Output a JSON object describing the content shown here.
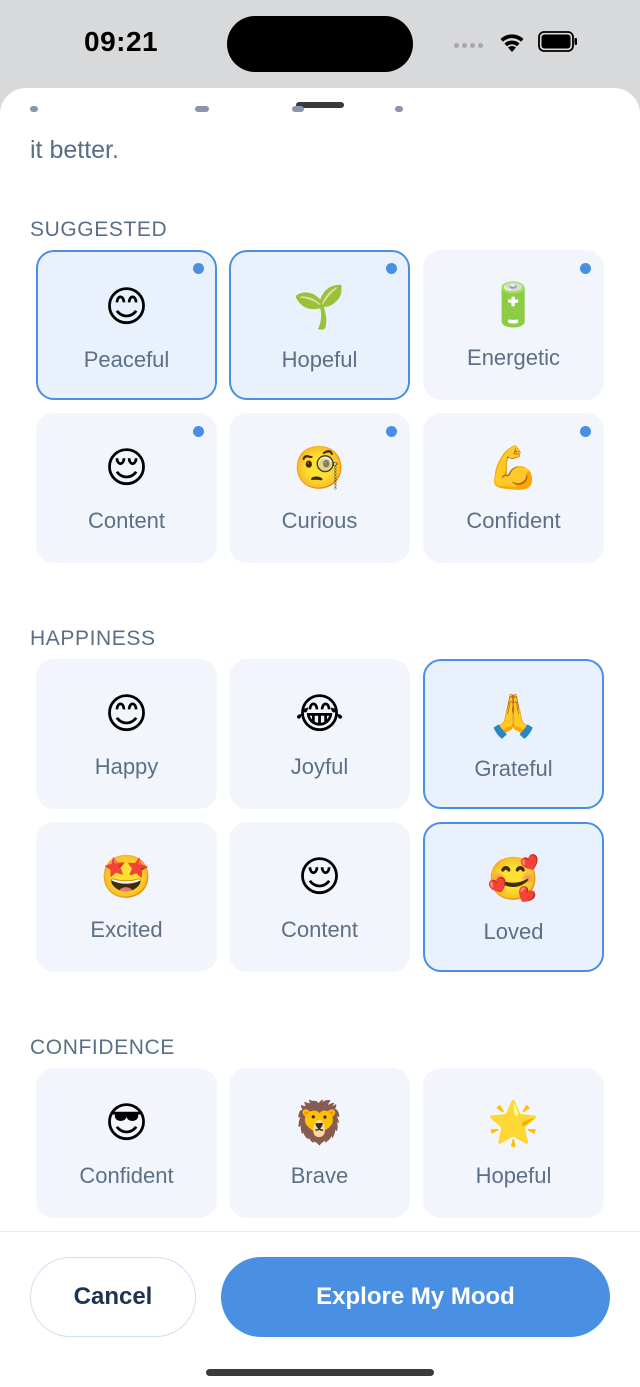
{
  "status_bar": {
    "time": "09:21"
  },
  "intro": {
    "text": "it better."
  },
  "sections": [
    {
      "title": "SUGGESTED",
      "cards": [
        {
          "emoji": "😊",
          "label": "Peaceful",
          "selected": true,
          "dot": true
        },
        {
          "emoji": "🌱",
          "label": "Hopeful",
          "selected": true,
          "dot": true
        },
        {
          "emoji": "🔋",
          "label": "Energetic",
          "selected": false,
          "dot": true
        },
        {
          "emoji": "😌",
          "label": "Content",
          "selected": false,
          "dot": true
        },
        {
          "emoji": "🧐",
          "label": "Curious",
          "selected": false,
          "dot": true
        },
        {
          "emoji": "💪",
          "label": "Confident",
          "selected": false,
          "dot": true
        }
      ]
    },
    {
      "title": "HAPPINESS",
      "cards": [
        {
          "emoji": "😊",
          "label": "Happy",
          "selected": false,
          "dot": false
        },
        {
          "emoji": "😂",
          "label": "Joyful",
          "selected": false,
          "dot": false
        },
        {
          "emoji": "🙏",
          "label": "Grateful",
          "selected": true,
          "dot": false
        },
        {
          "emoji": "🤩",
          "label": "Excited",
          "selected": false,
          "dot": false
        },
        {
          "emoji": "😌",
          "label": "Content",
          "selected": false,
          "dot": false
        },
        {
          "emoji": "🥰",
          "label": "Loved",
          "selected": true,
          "dot": false
        }
      ]
    },
    {
      "title": "CONFIDENCE",
      "cards": [
        {
          "emoji": "😎",
          "label": "Confident",
          "selected": false,
          "dot": false
        },
        {
          "emoji": "🦁",
          "label": "Brave",
          "selected": false,
          "dot": false
        },
        {
          "emoji": "🌟",
          "label": "Hopeful",
          "selected": false,
          "dot": false
        }
      ]
    }
  ],
  "footer": {
    "cancel_label": "Cancel",
    "primary_label": "Explore My Mood"
  },
  "colors": {
    "accent": "#4a90e2",
    "card_bg": "#f2f6fc",
    "card_selected_bg": "#e9f1fd",
    "label_text": "#5d6f85"
  }
}
